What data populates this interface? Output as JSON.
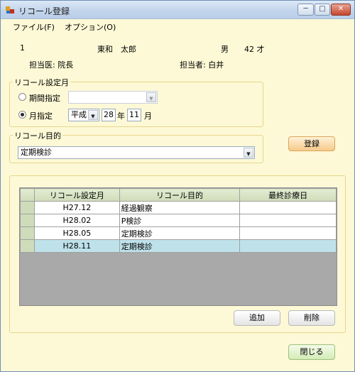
{
  "window": {
    "title": "リコール登録",
    "minimize": "─",
    "maximize": "□",
    "close": "✕"
  },
  "menu": {
    "file": "ファイル(F)",
    "options": "オプション(O)"
  },
  "patient": {
    "id": "1",
    "name": "東和　太郎",
    "gender": "男",
    "age": "42 才",
    "doctor": "担当医: 院長",
    "staff": "担当者: 白井"
  },
  "recall_month": {
    "group_title": "リコール設定月",
    "period_label": "期間指定",
    "period_value": "",
    "month_label": "月指定",
    "era": "平成",
    "year": "28",
    "year_unit": "年",
    "month": "11",
    "month_unit": "月",
    "selected": "月指定"
  },
  "recall_purpose": {
    "group_title": "リコール目的",
    "value": "定期検診"
  },
  "buttons": {
    "register": "登録",
    "add": "追加",
    "delete": "削除",
    "close": "閉じる"
  },
  "table": {
    "columns": [
      "リコール設定月",
      "リコール目的",
      "最終診療日"
    ],
    "rows": [
      [
        "H27.12",
        "経過観察",
        ""
      ],
      [
        "H28.02",
        "P検診",
        ""
      ],
      [
        "H28.05",
        "定期検診",
        ""
      ],
      [
        "H28.11",
        "定期検診",
        ""
      ]
    ],
    "selected_row": 3
  },
  "icons": {
    "app": "app-icon",
    "dropdown": "chevron-down-icon"
  }
}
